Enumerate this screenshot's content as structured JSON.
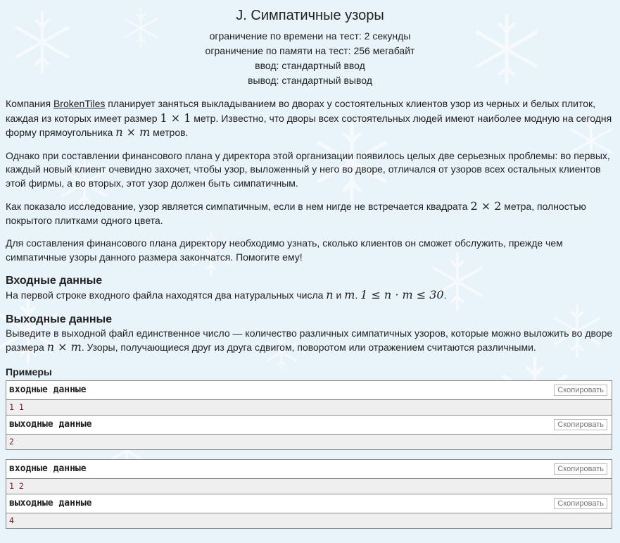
{
  "problem": {
    "title": "J. Симпатичные узоры",
    "time_limit": "ограничение по времени на тест: 2 секунды",
    "memory_limit": "ограничение по памяти на тест: 256 мегабайт",
    "input": "ввод: стандартный ввод",
    "output": "вывод: стандартный вывод"
  },
  "statement": {
    "p1_a": "Компания ",
    "p1_link": "BrokenTiles",
    "p1_b": " планирует заняться выкладыванием во дворах у состоятельных клиентов узор из черных и белых плиток, каждая из которых имеет размер ",
    "p1_math1": "1 × 1",
    "p1_c": " метр. Известно, что дворы всех состоятельных людей имеют наиболее модную на сегодня форму прямоугольника ",
    "p1_math2": "n × m",
    "p1_d": " метров.",
    "p2": "Однако при составлении финансового плана у директора этой организации появилось целых две серьезных проблемы: во первых, каждый новый клиент очевидно захочет, чтобы узор, выложенный у него во дворе, отличался от узоров всех остальных клиентов этой фирмы, а во вторых, этот узор должен быть симпатичным.",
    "p3_a": "Как показало исследование, узор является симпатичным, если в нем нигде не встречается квадрата ",
    "p3_math": "2 × 2",
    "p3_b": " метра, полностью покрытого плитками одного цвета.",
    "p4": "Для составления финансового плана директору необходимо узнать, сколько клиентов он сможет обслужить, прежде чем симпатичные узоры данного размера закончатся. Помогите ему!"
  },
  "input_section": {
    "heading": "Входные данные",
    "text_a": "На первой строке входного файла находятся два натуральных числа ",
    "n": "n",
    "and": " и ",
    "m": "m",
    "dot": ". ",
    "constraint": "1 ≤ n · m ≤ 30",
    "end": "."
  },
  "output_section": {
    "heading": "Выходные данные",
    "text_a": "Выведите в выходной файл единственное число — количество различных симпатичных узоров, которые можно выложить во дворе размера ",
    "math": "n × m",
    "text_b": ". Узоры, получающиеся друг из друга сдвигом, поворотом или отражением считаются различными."
  },
  "examples": {
    "heading": "Примеры",
    "input_label": "входные данные",
    "output_label": "выходные данные",
    "copy_label": "Скопировать",
    "items": [
      {
        "input": "1 1",
        "output": "2"
      },
      {
        "input": "1 2",
        "output": "4"
      }
    ]
  }
}
